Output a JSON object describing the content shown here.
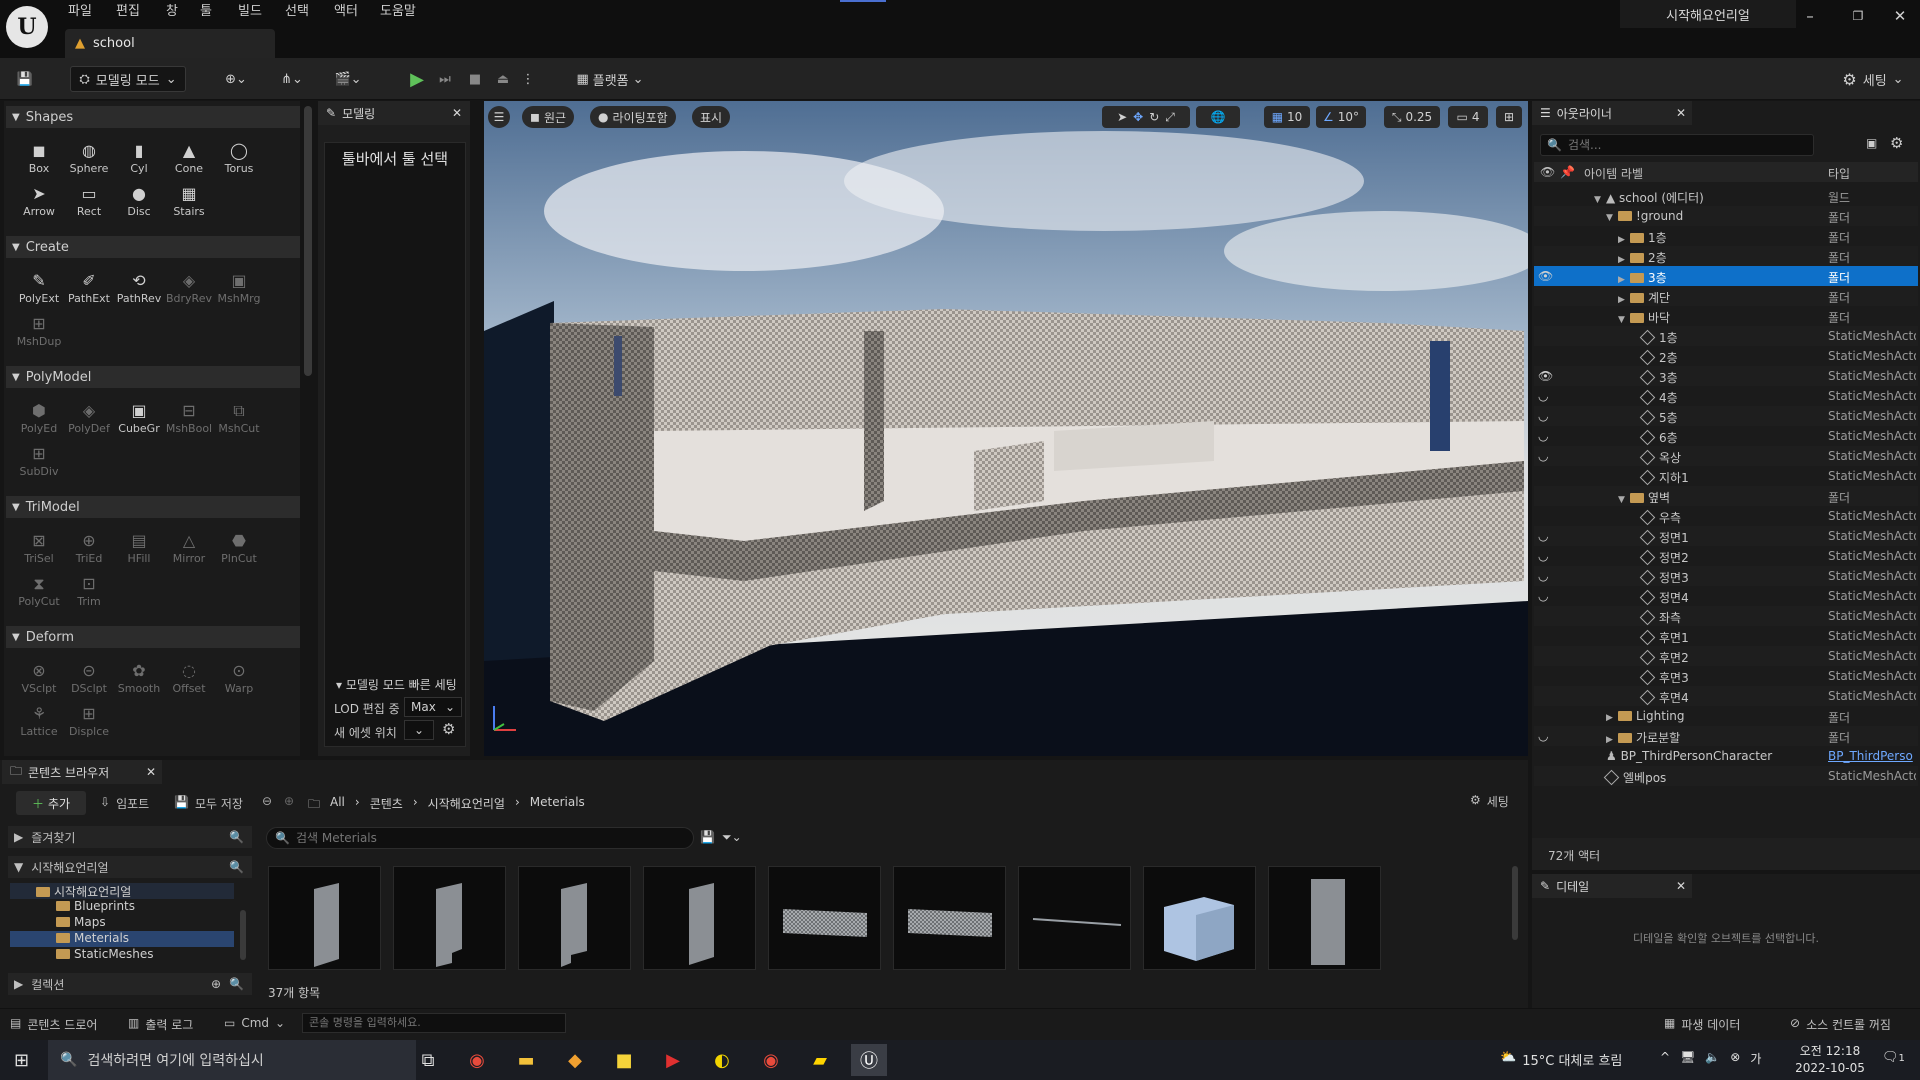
{
  "menu": [
    "파일",
    "편집",
    "창",
    "툴",
    "빌드",
    "선택",
    "액터",
    "도움말"
  ],
  "project_name": "시작해요언리얼",
  "level_tab": "school",
  "toolbar": {
    "mode": "모델링 모드",
    "platforms": "플랫폼",
    "settings": "세팅"
  },
  "tool_sections": [
    {
      "name": "Shapes",
      "tools": [
        [
          "Box",
          "Sphere",
          "Cyl",
          "Cone",
          "Torus"
        ],
        [
          "Arrow",
          "Rect",
          "Disc",
          "Stairs"
        ]
      ]
    },
    {
      "name": "Create",
      "tools": [
        [
          "PolyExt",
          "PathExt",
          "PathRev",
          "BdryRev",
          "MshMrg"
        ],
        [
          "MshDup"
        ]
      ]
    },
    {
      "name": "PolyModel",
      "tools": [
        [
          "PolyEd",
          "PolyDef",
          "CubeGr",
          "MshBool",
          "MshCut"
        ],
        [
          "SubDiv"
        ]
      ]
    },
    {
      "name": "TriModel",
      "tools": [
        [
          "TriSel",
          "TriEd",
          "HFill",
          "Mirror",
          "PlnCut"
        ],
        [
          "PolyCut",
          "Trim"
        ]
      ]
    },
    {
      "name": "Deform",
      "tools": [
        [
          "VSclpt",
          "DSclpt",
          "Smooth",
          "Offset",
          "Warp"
        ],
        [
          "Lattice",
          "Displce"
        ]
      ]
    }
  ],
  "modeling_panel": {
    "tab": "모델링",
    "title": "툴바에서 툴 선택",
    "quick_settings": "모델링 모드 빠른 세팅",
    "lod_label": "LOD 편집 중",
    "lod_value": "Max",
    "asset_location": "새 에셋 위치"
  },
  "viewport": {
    "perspective": "원근",
    "lighting": "라이팅포함",
    "show": "표시",
    "grid": "10",
    "angle": "10°",
    "scale": "0.25",
    "camera_speed": "4"
  },
  "outliner": {
    "tab": "아웃라이너",
    "search_placeholder": "검색...",
    "col_label": "아이템 라벨",
    "col_type": "타입",
    "rows": [
      {
        "label": "school (에디터)",
        "type": "월드",
        "indent": 0,
        "icon": "world",
        "arrow": "▼",
        "eye": ""
      },
      {
        "label": "!ground",
        "type": "폴더",
        "indent": 1,
        "icon": "folder",
        "arrow": "▼",
        "eye": ""
      },
      {
        "label": "1층",
        "type": "폴더",
        "indent": 2,
        "icon": "folder",
        "arrow": "▶",
        "eye": ""
      },
      {
        "label": "2층",
        "type": "폴더",
        "indent": 2,
        "icon": "folder",
        "arrow": "▶",
        "eye": ""
      },
      {
        "label": "3층",
        "type": "폴더",
        "indent": 2,
        "icon": "folder",
        "arrow": "▶",
        "eye": "👁",
        "selected": true
      },
      {
        "label": "계단",
        "type": "폴더",
        "indent": 2,
        "icon": "folder",
        "arrow": "▶",
        "eye": ""
      },
      {
        "label": "바닥",
        "type": "폴더",
        "indent": 2,
        "icon": "folder",
        "arrow": "▼",
        "eye": ""
      },
      {
        "label": "1층",
        "type": "StaticMeshActor",
        "indent": 3,
        "icon": "mesh",
        "arrow": "",
        "eye": ""
      },
      {
        "label": "2층",
        "type": "StaticMeshActor",
        "indent": 3,
        "icon": "mesh",
        "arrow": "",
        "eye": ""
      },
      {
        "label": "3층",
        "type": "StaticMeshActor",
        "indent": 3,
        "icon": "mesh",
        "arrow": "",
        "eye": "👁"
      },
      {
        "label": "4층",
        "type": "StaticMeshActor",
        "indent": 3,
        "icon": "mesh",
        "arrow": "",
        "eye": "◡"
      },
      {
        "label": "5층",
        "type": "StaticMeshActor",
        "indent": 3,
        "icon": "mesh",
        "arrow": "",
        "eye": "◡"
      },
      {
        "label": "6층",
        "type": "StaticMeshActor",
        "indent": 3,
        "icon": "mesh",
        "arrow": "",
        "eye": "◡"
      },
      {
        "label": "옥상",
        "type": "StaticMeshActor",
        "indent": 3,
        "icon": "mesh",
        "arrow": "",
        "eye": "◡"
      },
      {
        "label": "지하1",
        "type": "StaticMeshActor",
        "indent": 3,
        "icon": "mesh",
        "arrow": "",
        "eye": ""
      },
      {
        "label": "옆벽",
        "type": "폴더",
        "indent": 2,
        "icon": "folder",
        "arrow": "▼",
        "eye": ""
      },
      {
        "label": "우측",
        "type": "StaticMeshActor",
        "indent": 3,
        "icon": "mesh",
        "arrow": "",
        "eye": ""
      },
      {
        "label": "정면1",
        "type": "StaticMeshActor",
        "indent": 3,
        "icon": "mesh",
        "arrow": "",
        "eye": "◡"
      },
      {
        "label": "정면2",
        "type": "StaticMeshActor",
        "indent": 3,
        "icon": "mesh",
        "arrow": "",
        "eye": "◡"
      },
      {
        "label": "정면3",
        "type": "StaticMeshActor",
        "indent": 3,
        "icon": "mesh",
        "arrow": "",
        "eye": "◡"
      },
      {
        "label": "정면4",
        "type": "StaticMeshActor",
        "indent": 3,
        "icon": "mesh",
        "arrow": "",
        "eye": "◡"
      },
      {
        "label": "좌측",
        "type": "StaticMeshActor",
        "indent": 3,
        "icon": "mesh",
        "arrow": "",
        "eye": ""
      },
      {
        "label": "후면1",
        "type": "StaticMeshActor",
        "indent": 3,
        "icon": "mesh",
        "arrow": "",
        "eye": ""
      },
      {
        "label": "후면2",
        "type": "StaticMeshActor",
        "indent": 3,
        "icon": "mesh",
        "arrow": "",
        "eye": ""
      },
      {
        "label": "후면3",
        "type": "StaticMeshActor",
        "indent": 3,
        "icon": "mesh",
        "arrow": "",
        "eye": ""
      },
      {
        "label": "후면4",
        "type": "StaticMeshActor",
        "indent": 3,
        "icon": "mesh",
        "arrow": "",
        "eye": ""
      },
      {
        "label": "Lighting",
        "type": "폴더",
        "indent": 1,
        "icon": "folder",
        "arrow": "▶",
        "eye": ""
      },
      {
        "label": "가로분할",
        "type": "폴더",
        "indent": 1,
        "icon": "folder",
        "arrow": "▶",
        "eye": "◡"
      },
      {
        "label": "BP_ThirdPersonCharacter",
        "type": "BP_ThirdPerso",
        "indent": 0,
        "icon": "person",
        "arrow": "",
        "eye": "",
        "link": true
      },
      {
        "label": "엘베pos",
        "type": "StaticMeshActor",
        "indent": 0,
        "icon": "mesh",
        "arrow": "",
        "eye": ""
      }
    ],
    "actor_count": "72개 액터"
  },
  "details": {
    "tab": "디테일",
    "hint": "디테일을 확인할 오브젝트를 선택합니다."
  },
  "content_browser": {
    "tab": "콘텐츠 브라우저",
    "add": "추가",
    "import": "임포트",
    "save_all": "모두 저장",
    "breadcrumb": [
      "All",
      "콘텐츠",
      "시작해요언리얼",
      "Meterials"
    ],
    "settings": "세팅",
    "favorites": "즐겨찾기",
    "project": "시작해요언리얼",
    "tree": [
      "시작해요언리얼",
      "Blueprints",
      "Maps",
      "Meterials",
      "StaticMeshes"
    ],
    "collections": "컬렉션",
    "search_placeholder": "검색 Meterials",
    "item_count": "37개 항목"
  },
  "statusbar": {
    "content_drawer": "콘텐츠 드로어",
    "output_log": "출력 로그",
    "cmd": "Cmd",
    "console_placeholder": "콘솔 명령을 입력하세요.",
    "derived_data": "파생 데이터",
    "source_control": "소스 컨트롤 꺼짐"
  },
  "taskbar": {
    "search": "검색하려면 여기에 입력하십시",
    "weather": "15°C 대체로 흐림",
    "time": "오전 12:18",
    "date": "2022-10-05",
    "notif": "1"
  }
}
